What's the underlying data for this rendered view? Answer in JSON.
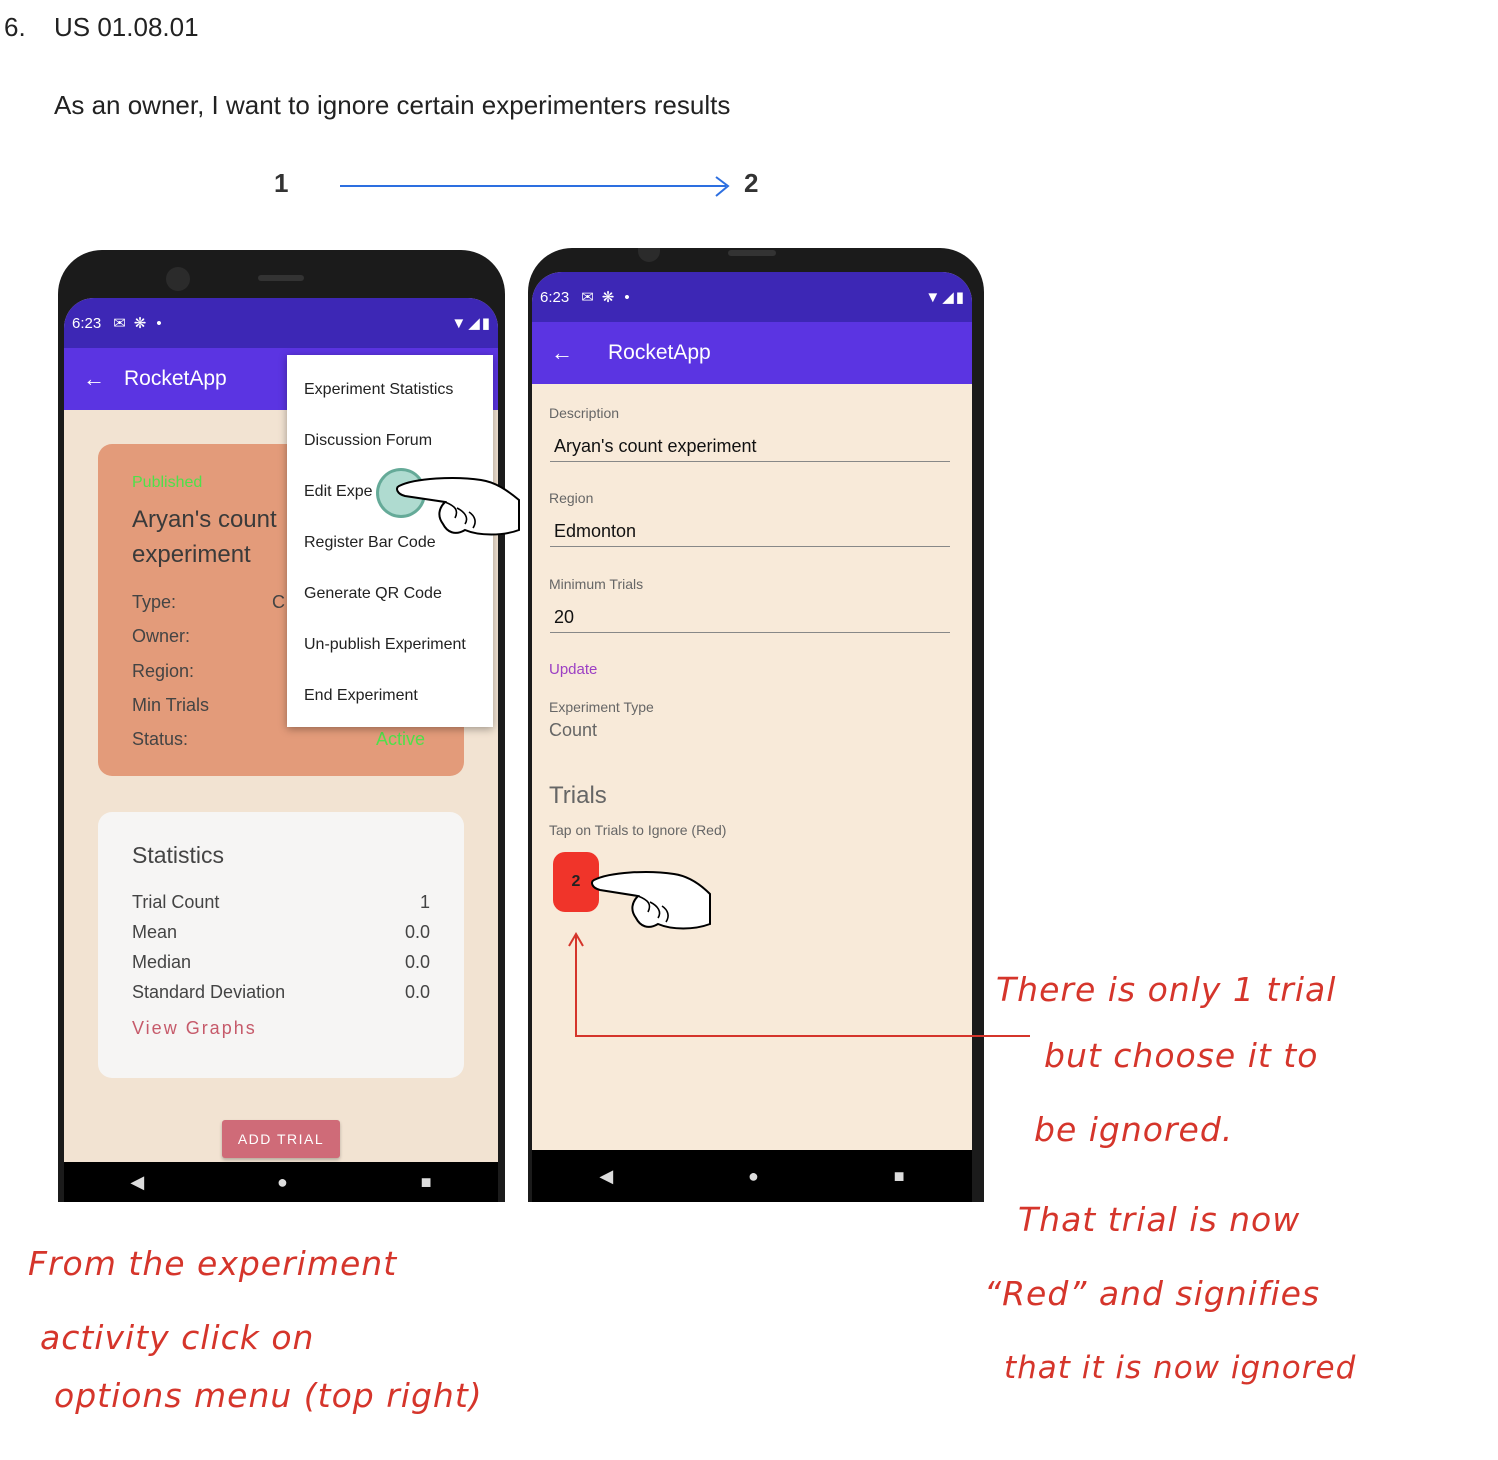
{
  "story": {
    "number": "6.",
    "id": "US 01.08.01",
    "text": "As an owner, I want to ignore certain experimenters results"
  },
  "steps": {
    "from": "1",
    "to": "2"
  },
  "colors": {
    "status_bar": "#3d27b5",
    "app_bar": "#5b34e2",
    "screen_bg": "#f2e3d2",
    "screen2_bg": "#f8ead9",
    "experiment_card": "#e39b7a",
    "published_green": "#4fe04a",
    "add_trial_button": "#cf6b78",
    "ignored_trial": "#f0342a",
    "update_purple": "#9c3fc4",
    "annotation_red": "#d5352b",
    "arrow_blue": "#2d6fe0"
  },
  "screen1": {
    "status_time": "6:23",
    "app_title": "RocketApp",
    "back_icon": "arrow-left-icon",
    "experiment_card": {
      "status_label": "Published",
      "title_line1": "Aryan's count",
      "title_line2": "experiment",
      "type_label": "Type:",
      "type_value_partial": "C",
      "owner_label": "Owner:",
      "region_label": "Region:",
      "min_trials_label": "Min Trials",
      "status_field_label": "Status:",
      "status_value": "Active"
    },
    "options_menu": [
      "Experiment Statistics",
      "Discussion Forum",
      "Edit Experiment",
      "Register Bar Code",
      "Generate QR Code",
      "Un-publish Experiment",
      "End Experiment"
    ],
    "options_menu_visible_edit": "Edit Expe",
    "statistics": {
      "title": "Statistics",
      "rows": [
        {
          "label": "Trial Count",
          "value": "1"
        },
        {
          "label": "Mean",
          "value": "0.0"
        },
        {
          "label": "Median",
          "value": "0.0"
        },
        {
          "label": "Standard Deviation",
          "value": "0.0"
        }
      ],
      "view_graphs": "View Graphs"
    },
    "add_trial": "ADD TRIAL"
  },
  "screen2": {
    "status_time": "6:23",
    "app_title": "RocketApp",
    "description_label": "Description",
    "description_value": "Aryan's count experiment",
    "region_label": "Region",
    "region_value": "Edmonton",
    "min_trials_label": "Minimum Trials",
    "min_trials_value": "20",
    "update_label": "Update",
    "experiment_type_label": "Experiment Type",
    "experiment_type_value": "Count",
    "trials_title": "Trials",
    "trials_hint": "Tap on Trials to Ignore (Red)",
    "trials": [
      "2"
    ]
  },
  "annotations": {
    "left": [
      "From the experiment",
      "activity click on",
      "options menu (top right)"
    ],
    "right_top": [
      "There is only 1 trial",
      "but choose it to",
      "be ignored."
    ],
    "right_bottom": [
      "That trial is now",
      "“Red” and signifies",
      "that it is now ignored"
    ]
  }
}
